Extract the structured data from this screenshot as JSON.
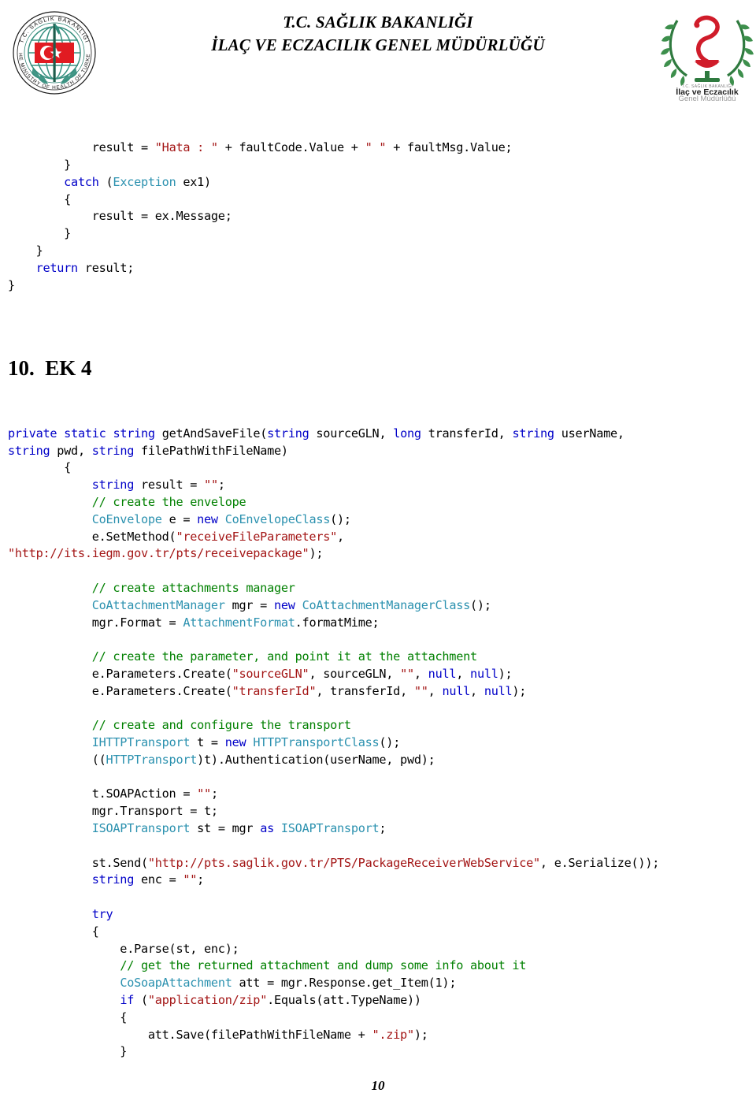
{
  "header": {
    "title_line1": "T.C. SAĞLIK BAKANLIĞI",
    "title_line2": "İLAÇ VE ECZACILIK GENEL MÜDÜRLÜĞÜ",
    "logo_left_name": "ministry-of-health-seal-logo",
    "logo_left_text_outer_top": "T.C. SAĞLIK BAKANLIĞI",
    "logo_left_text_outer_bottom": "THE MINISTRY OF HEALTH OF TURKEY",
    "logo_right_name": "ilac-ve-eczacilik-logo",
    "logo_right_text_small": "T.C. SAĞLIK BAKANLIĞI",
    "logo_right_text_line1": "İlaç ve Eczacılık",
    "logo_right_text_line2": "Genel Müdürlüğü"
  },
  "colors": {
    "keyword": "#0000C8",
    "type": "#2B91AF",
    "string": "#A31515",
    "comment": "#008000",
    "text": "#000000",
    "page_background": "#FFFFFF"
  },
  "code_top": {
    "lines": [
      [
        {
          "t": "            result = ",
          "c": "plain"
        },
        {
          "t": "\"Hata : \"",
          "c": "str"
        },
        {
          "t": " + faultCode.Value + ",
          "c": "plain"
        },
        {
          "t": "\" \"",
          "c": "str"
        },
        {
          "t": " + faultMsg.Value;",
          "c": "plain"
        }
      ],
      [
        {
          "t": "        }",
          "c": "plain"
        }
      ],
      [
        {
          "t": "        ",
          "c": "plain"
        },
        {
          "t": "catch",
          "c": "kw"
        },
        {
          "t": " (",
          "c": "plain"
        },
        {
          "t": "Exception",
          "c": "typ"
        },
        {
          "t": " ex1)",
          "c": "plain"
        }
      ],
      [
        {
          "t": "        {",
          "c": "plain"
        }
      ],
      [
        {
          "t": "            result = ex.Message;",
          "c": "plain"
        }
      ],
      [
        {
          "t": "        }",
          "c": "plain"
        }
      ],
      [
        {
          "t": "    }",
          "c": "plain"
        }
      ],
      [
        {
          "t": "    ",
          "c": "plain"
        },
        {
          "t": "return",
          "c": "kw"
        },
        {
          "t": " result;",
          "c": "plain"
        }
      ],
      [
        {
          "t": "}",
          "c": "plain"
        }
      ]
    ]
  },
  "section": {
    "number": "10.",
    "title": "EK 4",
    "full": "10.  EK 4"
  },
  "code_main": {
    "lines": [
      [
        {
          "t": "private",
          "c": "kw"
        },
        {
          "t": " ",
          "c": "plain"
        },
        {
          "t": "static",
          "c": "kw"
        },
        {
          "t": " ",
          "c": "plain"
        },
        {
          "t": "string",
          "c": "kw"
        },
        {
          "t": " getAndSaveFile(",
          "c": "plain"
        },
        {
          "t": "string",
          "c": "kw"
        },
        {
          "t": " sourceGLN, ",
          "c": "plain"
        },
        {
          "t": "long",
          "c": "kw"
        },
        {
          "t": " transferId, ",
          "c": "plain"
        },
        {
          "t": "string",
          "c": "kw"
        },
        {
          "t": " userName,",
          "c": "plain"
        }
      ],
      [
        {
          "t": "string",
          "c": "kw"
        },
        {
          "t": " pwd, ",
          "c": "plain"
        },
        {
          "t": "string",
          "c": "kw"
        },
        {
          "t": " filePathWithFileName)",
          "c": "plain"
        }
      ],
      [
        {
          "t": "        {",
          "c": "plain"
        }
      ],
      [
        {
          "t": "            ",
          "c": "plain"
        },
        {
          "t": "string",
          "c": "kw"
        },
        {
          "t": " result = ",
          "c": "plain"
        },
        {
          "t": "\"\"",
          "c": "str"
        },
        {
          "t": ";",
          "c": "plain"
        }
      ],
      [
        {
          "t": "            ",
          "c": "plain"
        },
        {
          "t": "// create the envelope",
          "c": "cmt"
        }
      ],
      [
        {
          "t": "            ",
          "c": "plain"
        },
        {
          "t": "CoEnvelope",
          "c": "typ"
        },
        {
          "t": " e = ",
          "c": "plain"
        },
        {
          "t": "new",
          "c": "kw"
        },
        {
          "t": " ",
          "c": "plain"
        },
        {
          "t": "CoEnvelopeClass",
          "c": "typ"
        },
        {
          "t": "();",
          "c": "plain"
        }
      ],
      [
        {
          "t": "            e.SetMethod(",
          "c": "plain"
        },
        {
          "t": "\"receiveFileParameters\"",
          "c": "str"
        },
        {
          "t": ",",
          "c": "plain"
        }
      ],
      [
        {
          "t": "\"http://its.iegm.gov.tr/pts/receivepackage\"",
          "c": "str"
        },
        {
          "t": ");",
          "c": "plain"
        }
      ],
      [
        {
          "t": "",
          "c": "plain"
        }
      ],
      [
        {
          "t": "            ",
          "c": "plain"
        },
        {
          "t": "// create attachments manager",
          "c": "cmt"
        }
      ],
      [
        {
          "t": "            ",
          "c": "plain"
        },
        {
          "t": "CoAttachmentManager",
          "c": "typ"
        },
        {
          "t": " mgr = ",
          "c": "plain"
        },
        {
          "t": "new",
          "c": "kw"
        },
        {
          "t": " ",
          "c": "plain"
        },
        {
          "t": "CoAttachmentManagerClass",
          "c": "typ"
        },
        {
          "t": "();",
          "c": "plain"
        }
      ],
      [
        {
          "t": "            mgr.Format = ",
          "c": "plain"
        },
        {
          "t": "AttachmentFormat",
          "c": "typ"
        },
        {
          "t": ".formatMime;",
          "c": "plain"
        }
      ],
      [
        {
          "t": "",
          "c": "plain"
        }
      ],
      [
        {
          "t": "            ",
          "c": "plain"
        },
        {
          "t": "// create the parameter, and point it at the attachment",
          "c": "cmt"
        }
      ],
      [
        {
          "t": "            e.Parameters.Create(",
          "c": "plain"
        },
        {
          "t": "\"sourceGLN\"",
          "c": "str"
        },
        {
          "t": ", sourceGLN, ",
          "c": "plain"
        },
        {
          "t": "\"\"",
          "c": "str"
        },
        {
          "t": ", ",
          "c": "plain"
        },
        {
          "t": "null",
          "c": "kw"
        },
        {
          "t": ", ",
          "c": "plain"
        },
        {
          "t": "null",
          "c": "kw"
        },
        {
          "t": ");",
          "c": "plain"
        }
      ],
      [
        {
          "t": "            e.Parameters.Create(",
          "c": "plain"
        },
        {
          "t": "\"transferId\"",
          "c": "str"
        },
        {
          "t": ", transferId, ",
          "c": "plain"
        },
        {
          "t": "\"\"",
          "c": "str"
        },
        {
          "t": ", ",
          "c": "plain"
        },
        {
          "t": "null",
          "c": "kw"
        },
        {
          "t": ", ",
          "c": "plain"
        },
        {
          "t": "null",
          "c": "kw"
        },
        {
          "t": ");",
          "c": "plain"
        }
      ],
      [
        {
          "t": "",
          "c": "plain"
        }
      ],
      [
        {
          "t": "            ",
          "c": "plain"
        },
        {
          "t": "// create and configure the transport",
          "c": "cmt"
        }
      ],
      [
        {
          "t": "            ",
          "c": "plain"
        },
        {
          "t": "IHTTPTransport",
          "c": "typ"
        },
        {
          "t": " t = ",
          "c": "plain"
        },
        {
          "t": "new",
          "c": "kw"
        },
        {
          "t": " ",
          "c": "plain"
        },
        {
          "t": "HTTPTransportClass",
          "c": "typ"
        },
        {
          "t": "();",
          "c": "plain"
        }
      ],
      [
        {
          "t": "            ((",
          "c": "plain"
        },
        {
          "t": "HTTPTransport",
          "c": "typ"
        },
        {
          "t": ")t).Authentication(userName, pwd);",
          "c": "plain"
        }
      ],
      [
        {
          "t": "",
          "c": "plain"
        }
      ],
      [
        {
          "t": "            t.SOAPAction = ",
          "c": "plain"
        },
        {
          "t": "\"\"",
          "c": "str"
        },
        {
          "t": ";",
          "c": "plain"
        }
      ],
      [
        {
          "t": "            mgr.Transport = t;",
          "c": "plain"
        }
      ],
      [
        {
          "t": "            ",
          "c": "plain"
        },
        {
          "t": "ISOAPTransport",
          "c": "typ"
        },
        {
          "t": " st = mgr ",
          "c": "plain"
        },
        {
          "t": "as",
          "c": "kw"
        },
        {
          "t": " ",
          "c": "plain"
        },
        {
          "t": "ISOAPTransport",
          "c": "typ"
        },
        {
          "t": ";",
          "c": "plain"
        }
      ],
      [
        {
          "t": "",
          "c": "plain"
        }
      ],
      [
        {
          "t": "            st.Send(",
          "c": "plain"
        },
        {
          "t": "\"http://pts.saglik.gov.tr/PTS/PackageReceiverWebService\"",
          "c": "str"
        },
        {
          "t": ", e.Serialize());",
          "c": "plain"
        }
      ],
      [
        {
          "t": "            ",
          "c": "plain"
        },
        {
          "t": "string",
          "c": "kw"
        },
        {
          "t": " enc = ",
          "c": "plain"
        },
        {
          "t": "\"\"",
          "c": "str"
        },
        {
          "t": ";",
          "c": "plain"
        }
      ],
      [
        {
          "t": "",
          "c": "plain"
        }
      ],
      [
        {
          "t": "            ",
          "c": "plain"
        },
        {
          "t": "try",
          "c": "kw"
        }
      ],
      [
        {
          "t": "            {",
          "c": "plain"
        }
      ],
      [
        {
          "t": "                e.Parse(st, enc);",
          "c": "plain"
        }
      ],
      [
        {
          "t": "                ",
          "c": "plain"
        },
        {
          "t": "// get the returned attachment and dump some info about it",
          "c": "cmt"
        }
      ],
      [
        {
          "t": "                ",
          "c": "plain"
        },
        {
          "t": "CoSoapAttachment",
          "c": "typ"
        },
        {
          "t": " att = mgr.Response.get_Item(1);",
          "c": "plain"
        }
      ],
      [
        {
          "t": "                ",
          "c": "plain"
        },
        {
          "t": "if",
          "c": "kw"
        },
        {
          "t": " (",
          "c": "plain"
        },
        {
          "t": "\"application/zip\"",
          "c": "str"
        },
        {
          "t": ".Equals(att.TypeName))",
          "c": "plain"
        }
      ],
      [
        {
          "t": "                {",
          "c": "plain"
        }
      ],
      [
        {
          "t": "                    att.Save(filePathWithFileName + ",
          "c": "plain"
        },
        {
          "t": "\".zip\"",
          "c": "str"
        },
        {
          "t": ");",
          "c": "plain"
        }
      ],
      [
        {
          "t": "                }",
          "c": "plain"
        }
      ]
    ]
  },
  "footer": {
    "page_number": "10"
  }
}
